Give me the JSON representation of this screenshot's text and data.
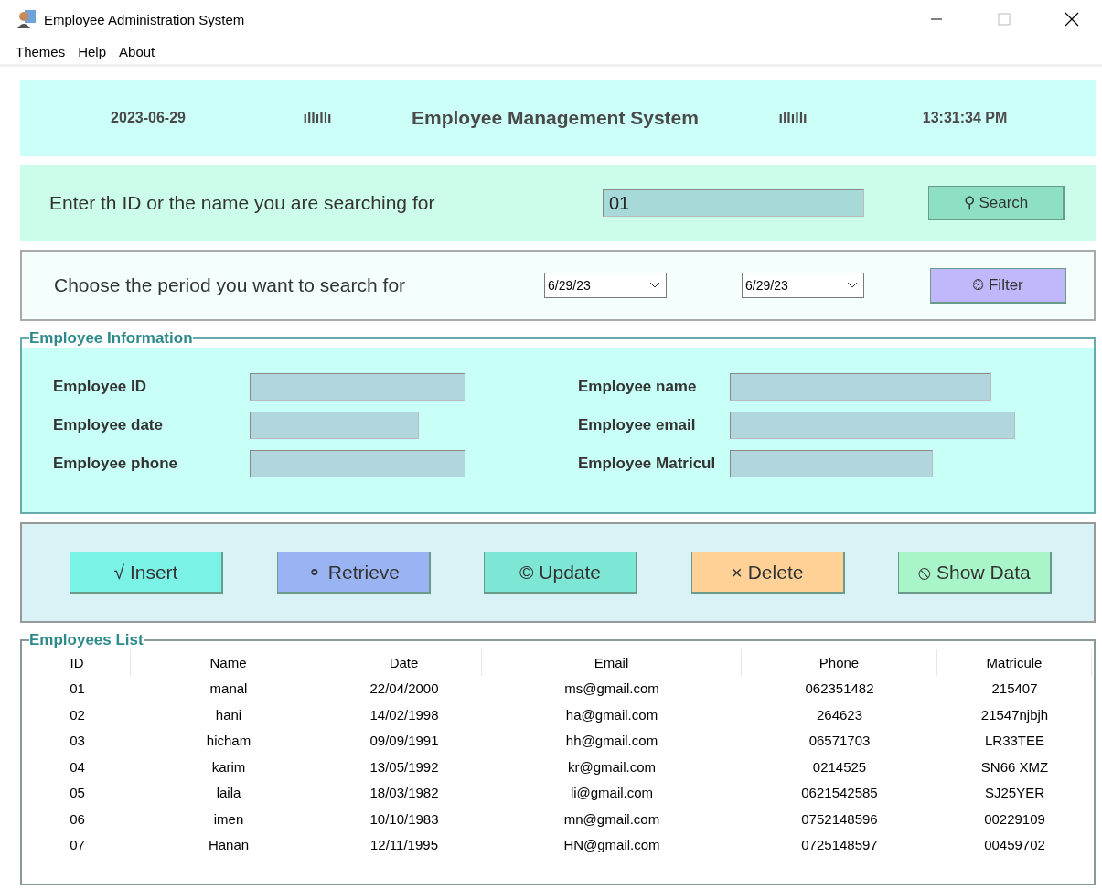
{
  "window": {
    "title": "Employee Administration System"
  },
  "menu": [
    "Themes",
    "Help",
    "About"
  ],
  "header": {
    "date": "2023-06-29",
    "left_mark": "ıllıllı",
    "title": "Employee Management System",
    "right_mark": "ıllıllı",
    "time": "13:31:34 PM"
  },
  "search": {
    "label": "Enter th ID or the name you are searching for",
    "value": "01",
    "button": "⚲ Search"
  },
  "period": {
    "label": "Choose the period you want to search for",
    "from": "6/29/23",
    "to": "6/29/23",
    "button": "⏲ Filter"
  },
  "employee_info": {
    "title": "Employee Information",
    "fields": [
      {
        "label": "Employee ID"
      },
      {
        "label": "Employee name"
      },
      {
        "label": "Employee date"
      },
      {
        "label": "Employee email"
      },
      {
        "label": "Employee phone"
      },
      {
        "label": "Employee Matricul"
      }
    ]
  },
  "actions": [
    {
      "label": "√ Insert",
      "color": "#7af2e6"
    },
    {
      "label": "⚬ Retrieve",
      "color": "#9ab3f2"
    },
    {
      "label": "© Update",
      "color": "#7de6d4"
    },
    {
      "label": "× Delete",
      "color": "#ffd196"
    },
    {
      "label": "⦸ Show Data",
      "color": "#a8f5c9"
    }
  ],
  "employees_list": {
    "title": "Employees List",
    "columns": [
      "ID",
      "Name",
      "Date",
      "Email",
      "Phone",
      "Matricule"
    ],
    "rows": [
      [
        "01",
        "manal",
        "22/04/2000",
        "ms@gmail.com",
        "062351482",
        "215407"
      ],
      [
        "02",
        "hani",
        "14/02/1998",
        "ha@gmail.com",
        "264623",
        "21547njbjh"
      ],
      [
        "03",
        "hicham",
        "09/09/1991",
        "hh@gmail.com",
        "06571703",
        "LR33TEE"
      ],
      [
        "04",
        "karim",
        "13/05/1992",
        "kr@gmail.com",
        "0214525",
        "SN66 XMZ"
      ],
      [
        "05",
        "laila",
        "18/03/1982",
        "li@gmail.com",
        "0621542585",
        "SJ25YER"
      ],
      [
        "06",
        "imen",
        "10/10/1983",
        "mn@gmail.com",
        "0752148596",
        "00229109"
      ],
      [
        "07",
        "Hanan",
        "12/11/1995",
        "HN@gmail.com",
        "0725148597",
        "00459702"
      ]
    ]
  }
}
